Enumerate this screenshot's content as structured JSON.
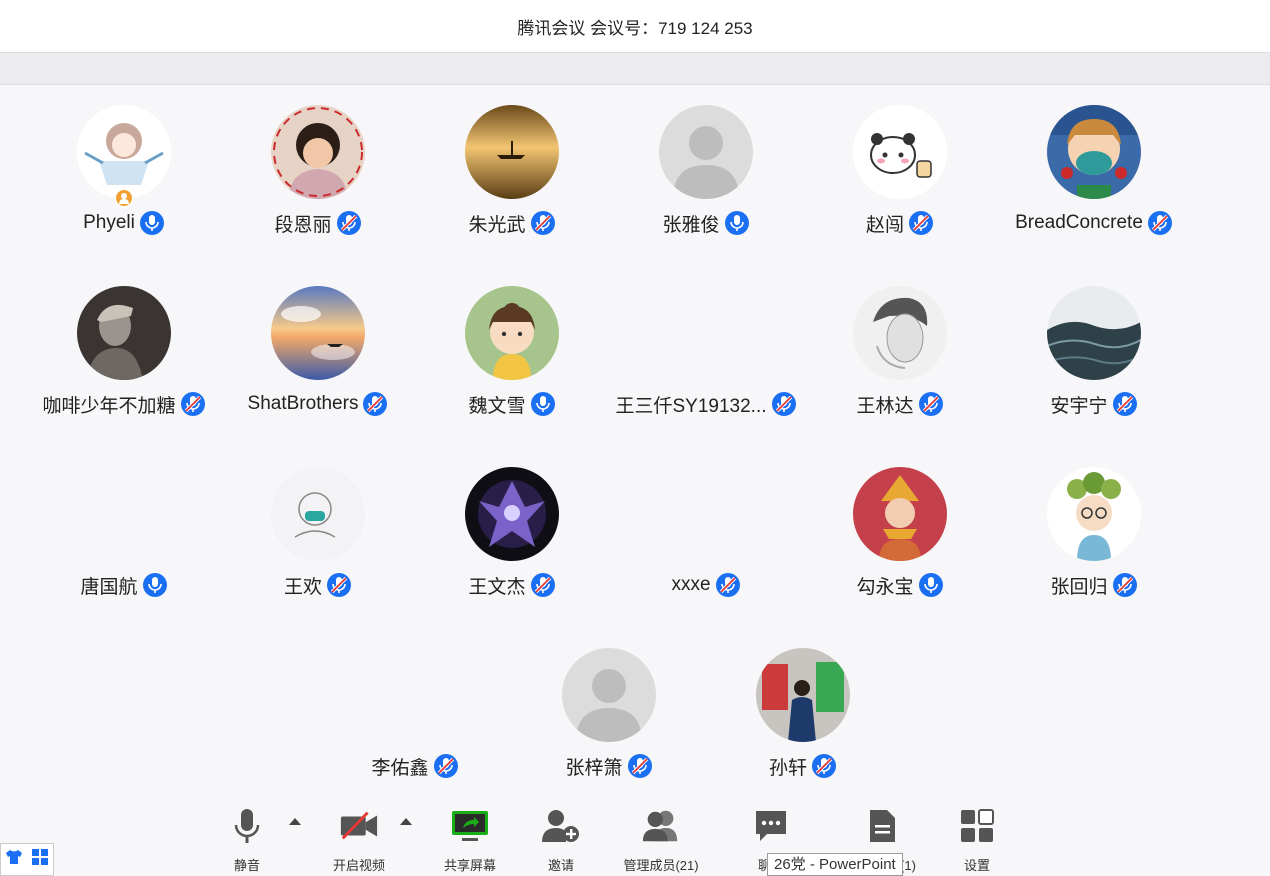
{
  "window": {
    "title": "腾讯会议 会议号：719 124 253"
  },
  "participants": [
    {
      "name": "Phyeli",
      "avatar": "girl-illustration",
      "host": true
    },
    {
      "name": "段恩丽",
      "avatar": "child-photo"
    },
    {
      "name": "朱光武",
      "avatar": "boat-sunset"
    },
    {
      "name": "张雅俊",
      "avatar": "default-person"
    },
    {
      "name": "赵闯",
      "avatar": "panda-sticker"
    },
    {
      "name": "BreadConcrete",
      "avatar": "anime-boy-mask"
    },
    {
      "name": "咖啡少年不加糖",
      "avatar": "bw-portrait"
    },
    {
      "name": "ShatBrothers",
      "avatar": "sky-reflection"
    },
    {
      "name": "魏文雪",
      "avatar": "cartoon-girl"
    },
    {
      "name": "王三仟SY19132...",
      "avatar": "none"
    },
    {
      "name": "王林达",
      "avatar": "sketch-face"
    },
    {
      "name": "安宇宁",
      "avatar": "sea-waves"
    },
    {
      "name": "唐国航",
      "avatar": "none"
    },
    {
      "name": "王欢",
      "avatar": "doodle-mask"
    },
    {
      "name": "王文杰",
      "avatar": "dark-hero"
    },
    {
      "name": "xxxe",
      "avatar": "none"
    },
    {
      "name": "勾永宝",
      "avatar": "girl-yellow-hat"
    },
    {
      "name": "张回归",
      "avatar": "cartoon-leaf-boy"
    },
    {
      "name": "李佑鑫",
      "avatar": "none"
    },
    {
      "name": "张梓箫",
      "avatar": "default-person"
    },
    {
      "name": "孙轩",
      "avatar": "man-photo"
    }
  ],
  "toolbar": {
    "mute": "静音",
    "video": "开启视频",
    "share": "共享屏幕",
    "invite": "邀请",
    "members": "管理成员(21)",
    "chat": "聊天",
    "docs": "会议文档(1)",
    "settings": "设置"
  },
  "tooltip": "26党 - PowerPoint",
  "colors": {
    "accent": "#1a6ff2",
    "mic_muted_slash": "#e53935",
    "share_green": "#1aad19",
    "host_badge": "#f0a030"
  }
}
